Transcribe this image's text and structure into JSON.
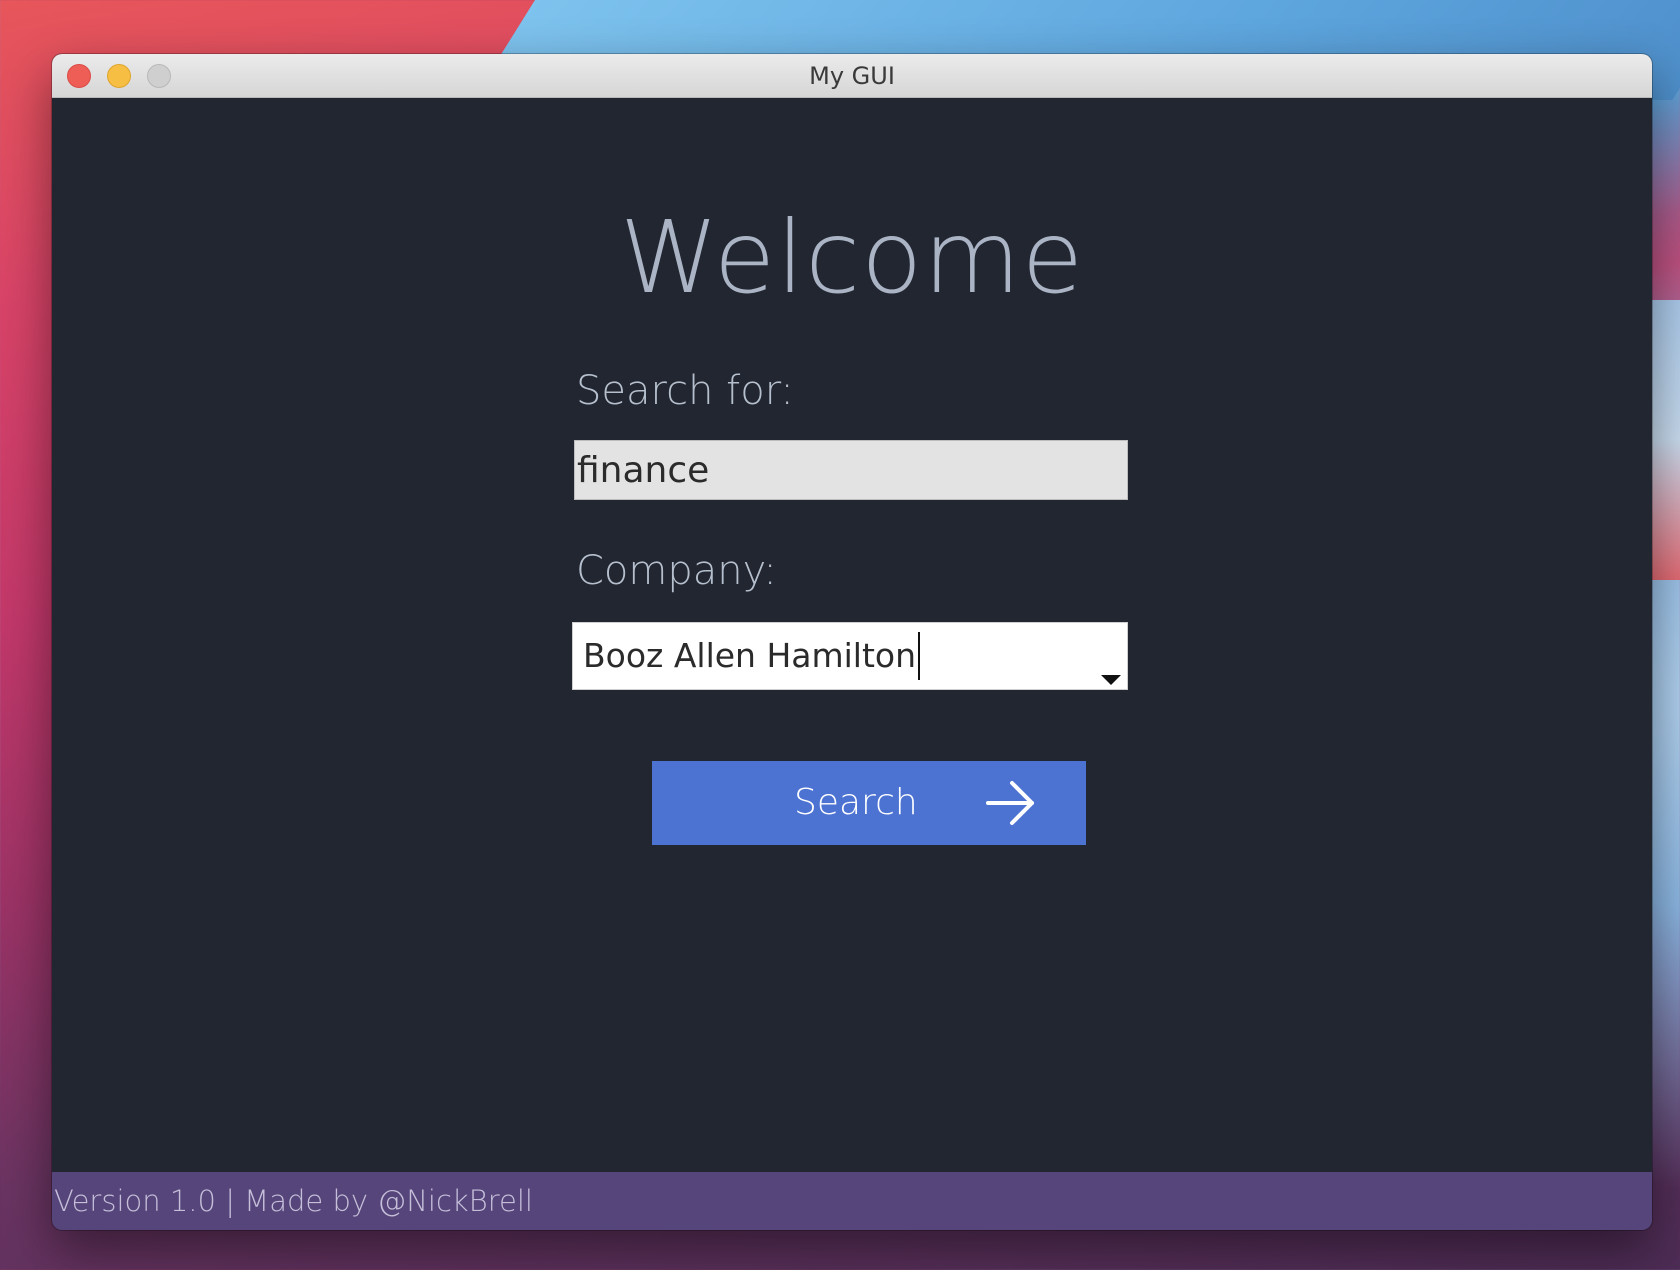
{
  "window": {
    "title": "My GUI"
  },
  "main": {
    "heading": "Welcome",
    "search_label": "Search for:",
    "search_value": "finance",
    "company_label": "Company:",
    "company_value": "Booz Allen Hamilton",
    "search_button_label": "Search"
  },
  "footer": {
    "text": "Version 1.0 | Made by @NickBrell"
  },
  "colors": {
    "content_background": "#222630",
    "heading_text": "#aab4c5",
    "button_background": "#4c72d2",
    "footer_background": "#56457a"
  },
  "icons": {
    "button_icon": "arrow-right-icon",
    "dropdown_icon": "dropdown-triangle-icon"
  }
}
